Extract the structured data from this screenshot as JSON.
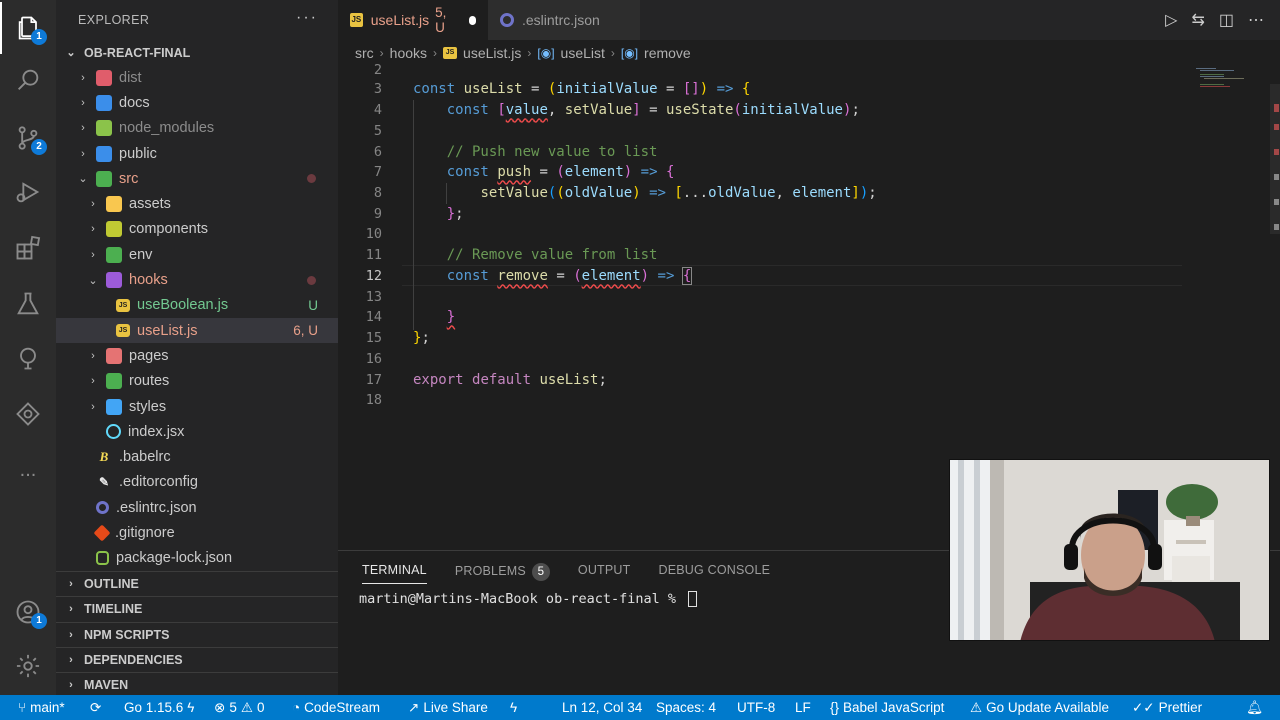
{
  "activity_bar": {
    "explorer_badge": "1",
    "scm_badge": "2",
    "accounts_badge": "1",
    "more_label": "..."
  },
  "sidebar": {
    "title": "EXPLORER",
    "more": "···",
    "root": "OB-REACT-FINAL",
    "items": [
      {
        "label": "dist",
        "chev": "›",
        "icon_color": "#e05d6b"
      },
      {
        "label": "docs",
        "chev": "›",
        "icon_color": "#3b8eea"
      },
      {
        "label": "node_modules",
        "chev": "›",
        "icon_color": "#8bc34a"
      },
      {
        "label": "public",
        "chev": "›",
        "icon_color": "#3b8eea"
      },
      {
        "label": "src",
        "chev": "⌄",
        "icon_color": "#4caf50"
      },
      {
        "label": "assets",
        "chev": "›",
        "icon_color": "#f9c74f"
      },
      {
        "label": "components",
        "chev": "›",
        "icon_color": "#c0ca33"
      },
      {
        "label": "env",
        "chev": "›",
        "icon_color": "#4caf50"
      },
      {
        "label": "hooks",
        "chev": "⌄",
        "icon_color": "#9c5bd9"
      },
      {
        "label": "useBoolean.js",
        "status": "U"
      },
      {
        "label": "useList.js",
        "status": "6, U"
      },
      {
        "label": "pages",
        "chev": "›",
        "icon_color": "#e57373"
      },
      {
        "label": "routes",
        "chev": "›",
        "icon_color": "#4caf50"
      },
      {
        "label": "styles",
        "chev": "›",
        "icon_color": "#42a5f5"
      },
      {
        "label": "index.jsx"
      },
      {
        "label": ".babelrc"
      },
      {
        "label": ".editorconfig"
      },
      {
        "label": ".eslintrc.json"
      },
      {
        "label": ".gitignore"
      },
      {
        "label": "package-lock.json"
      }
    ],
    "sections": [
      "OUTLINE",
      "TIMELINE",
      "NPM SCRIPTS",
      "DEPENDENCIES",
      "MAVEN"
    ]
  },
  "tabs": {
    "active": {
      "label": "useList.js",
      "status": "5, U"
    },
    "inactive": {
      "label": ".eslintrc.json"
    }
  },
  "breadcrumb": {
    "parts": [
      "src",
      "hooks",
      "useList.js",
      "useList",
      "remove"
    ]
  },
  "editor": {
    "line_numbers": [
      "2",
      "3",
      "4",
      "5",
      "6",
      "7",
      "8",
      "9",
      "10",
      "11",
      "12",
      "13",
      "14",
      "15",
      "16",
      "17",
      "18"
    ],
    "current_line": "12",
    "comment_push": "// Push new value to list",
    "comment_remove": "// Remove value from list"
  },
  "panel": {
    "tabs": [
      "TERMINAL",
      "PROBLEMS",
      "OUTPUT",
      "DEBUG CONSOLE"
    ],
    "problems_count": "5",
    "prompt": "martin@Martins-MacBook ob-react-final % "
  },
  "statusbar": {
    "branch": "main*",
    "go_version": "Go 1.15.6",
    "errors": "5",
    "warnings": "0",
    "codestream": "CodeStream",
    "live_share": "Live Share",
    "position": "Ln 12, Col 34",
    "spaces": "Spaces: 4",
    "encoding": "UTF-8",
    "eol": "LF",
    "language": "Babel JavaScript",
    "go_update": "Go Update Available",
    "prettier": "Prettier"
  },
  "colors": {
    "accent": "#007acc",
    "modified": "#e8a08a",
    "untracked": "#73c991"
  }
}
